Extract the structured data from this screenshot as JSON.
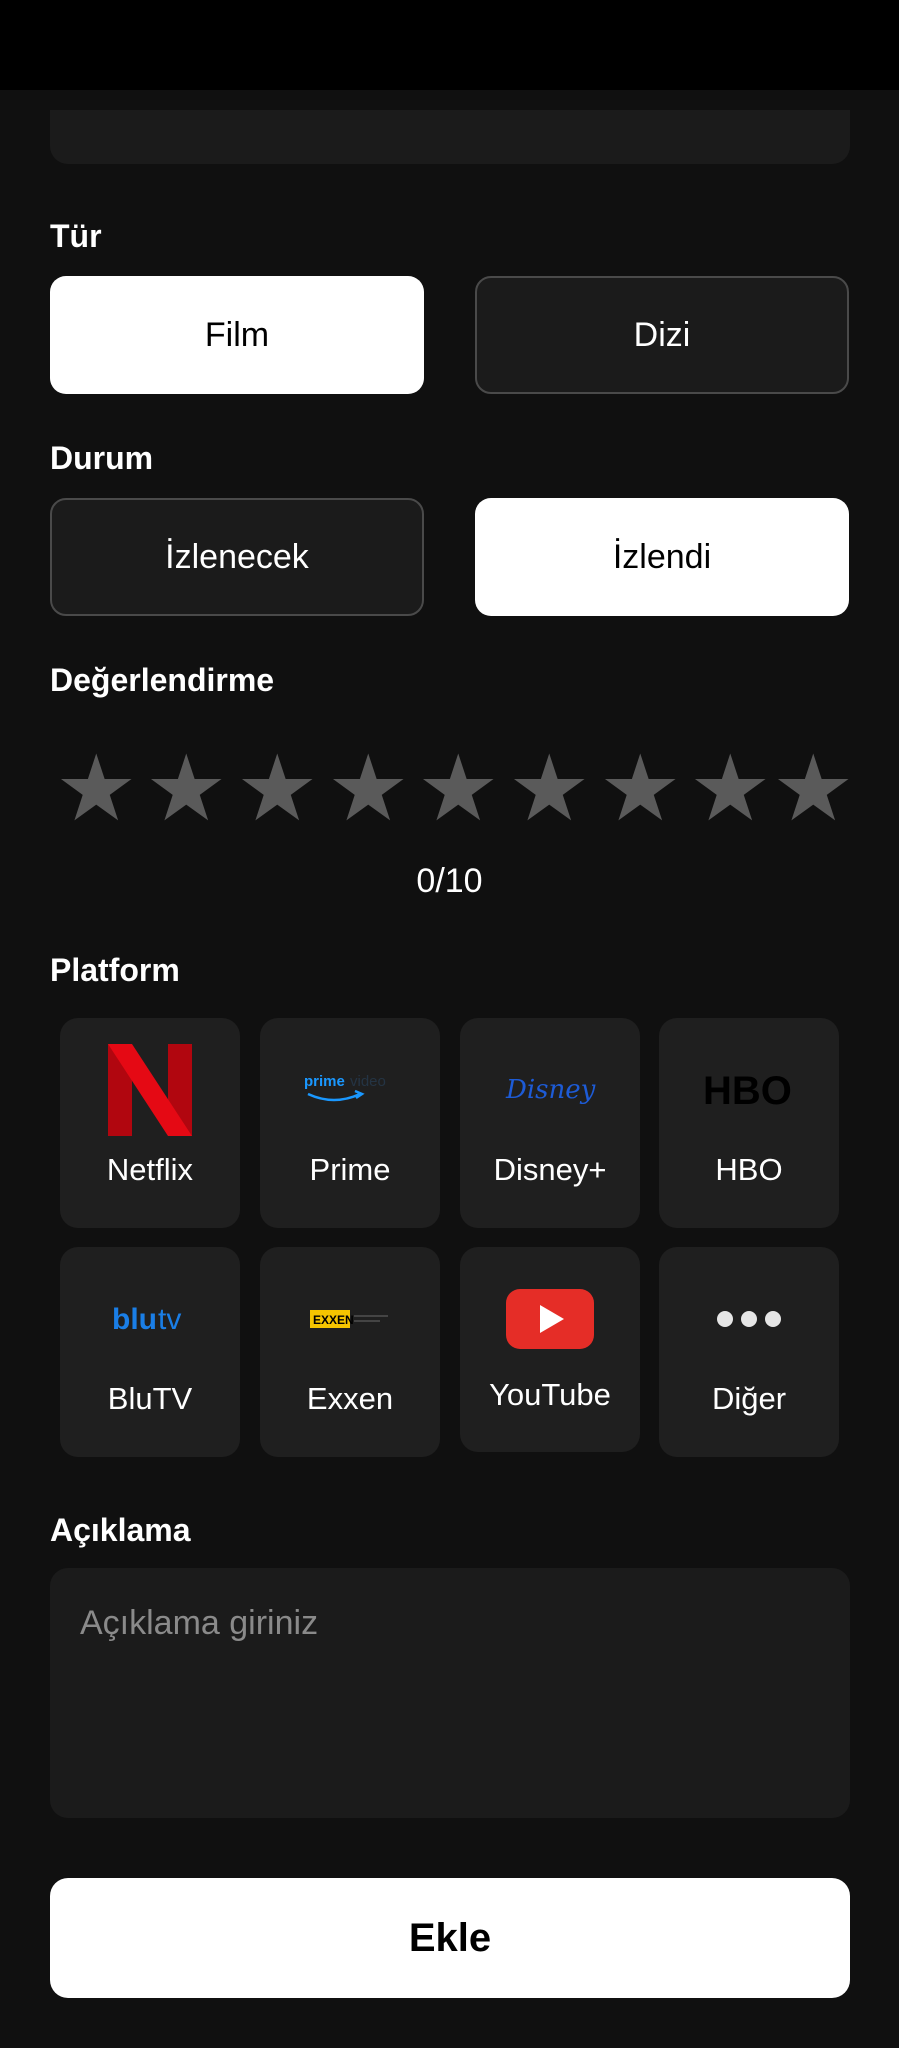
{
  "type_section": {
    "label": "Tür",
    "options": [
      "Film",
      "Dizi"
    ],
    "selected": "Film"
  },
  "status_section": {
    "label": "Durum",
    "options": [
      "İzlenecek",
      "İzlendi"
    ],
    "selected": "İzlendi"
  },
  "rating_section": {
    "label": "Değerlendirme",
    "stars": 9,
    "value_text": "0/10",
    "star_color": "#5a5a5a"
  },
  "platform_section": {
    "label": "Platform",
    "items": [
      {
        "label": "Netflix",
        "icon": "netflix-logo"
      },
      {
        "label": "Prime",
        "icon": "prime-video-logo"
      },
      {
        "label": "Disney+",
        "icon": "disney-logo"
      },
      {
        "label": "HBO",
        "icon": "hbo-logo"
      },
      {
        "label": "BluTV",
        "icon": "blutv-logo"
      },
      {
        "label": "Exxen",
        "icon": "exxen-logo"
      },
      {
        "label": "YouTube",
        "icon": "youtube-logo"
      },
      {
        "label": "Diğer",
        "icon": "more-icon"
      }
    ]
  },
  "description_section": {
    "label": "Açıklama",
    "placeholder": "Açıklama giriniz",
    "value": ""
  },
  "submit": {
    "label": "Ekle"
  },
  "colors": {
    "background": "#101010",
    "card": "#1f1f1f",
    "selected": "#ffffff",
    "netflix_red": "#e50914",
    "youtube_red": "#e52d27",
    "blutv_blue": "#1a7ee6"
  }
}
